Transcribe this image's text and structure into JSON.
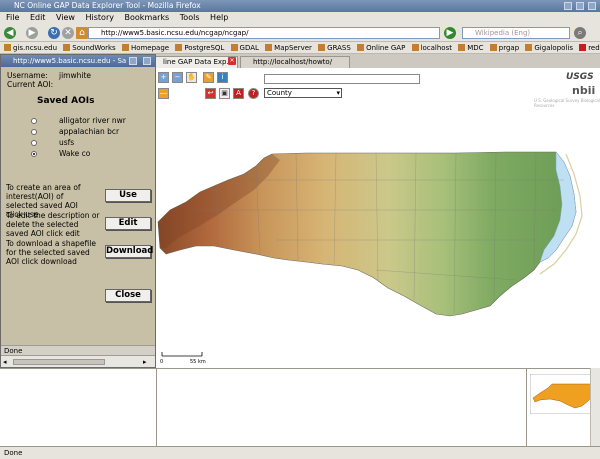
{
  "window": {
    "title": "NC Online GAP Data Explorer Tool - Mozilla Firefox"
  },
  "menu": [
    "File",
    "Edit",
    "View",
    "History",
    "Bookmarks",
    "Tools",
    "Help"
  ],
  "nav": {
    "url": "http://www5.basic.ncsu.edu/ncgap/ncgap/",
    "search_placeholder": "Wikipedia (Eng)"
  },
  "bookmarks": [
    "gis.ncsu.edu",
    "SoundWorks",
    "Homepage",
    "PostgreSQL",
    "GDAL",
    "MapServer",
    "GRASS",
    "Online GAP",
    "localhost",
    "MDC",
    "prgap",
    "Gigalopolis",
    "redhat"
  ],
  "tabs": [
    {
      "label": "line GAP Data Exp...",
      "active": true
    },
    {
      "label": "http://localhost/howto/",
      "active": false
    }
  ],
  "popup": {
    "title": "http://www5.basic.ncsu.edu - Sa",
    "username_label": "Username:",
    "username_value": "jimwhite",
    "current_aoi_label": "Current AOI:",
    "heading": "Saved AOIs",
    "aois": [
      {
        "name": "alligator river nwr",
        "selected": false
      },
      {
        "name": "appalachian bcr",
        "selected": false
      },
      {
        "name": "usfs",
        "selected": false
      },
      {
        "name": "Wake co",
        "selected": true
      }
    ],
    "use_text": "To create an area of interest(AOI) of selected saved AOI click use",
    "edit_text": "To edit the description or delete the selected saved AOI click edit",
    "download_text": "To download a shapefile for the selected saved AOI click download",
    "use_label": "Use",
    "edit_label": "Edit",
    "download_label": "Download",
    "close_label": "Close",
    "status": "Done"
  },
  "map": {
    "layer_select": "County",
    "logo_usgs": "USGS",
    "logo_nbii": "nbii",
    "credit": "U.S. Geological Survey Biological Resources",
    "scale_start": "0",
    "scale_end": "55 km"
  },
  "status": "Done",
  "colors": {
    "popup_bg": "#c8c0a6",
    "titlebar": "#5a77a0",
    "map_water": "#bfe0f2",
    "inset_fill": "#f0a020"
  }
}
